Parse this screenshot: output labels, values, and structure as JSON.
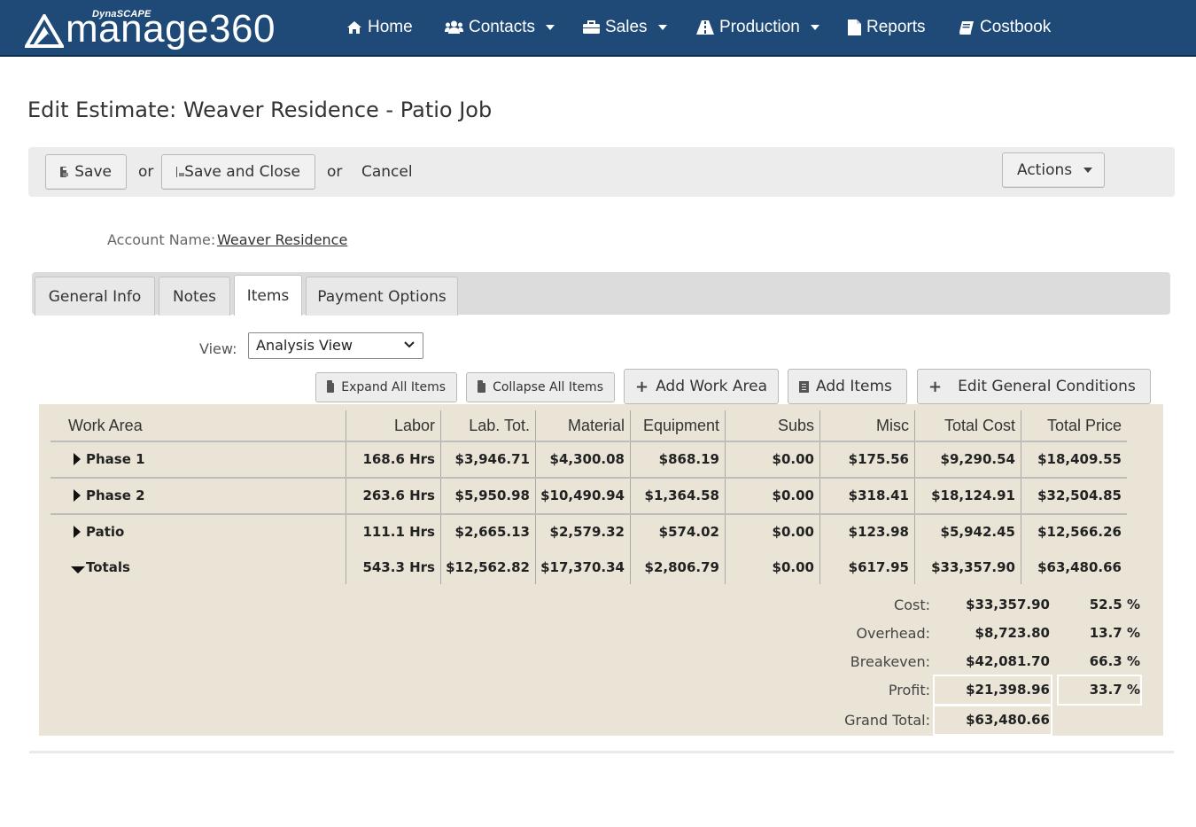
{
  "brand": {
    "small": "DynaSCAPE",
    "big": "manage360"
  },
  "nav": {
    "home": "Home",
    "contacts": "Contacts",
    "sales": "Sales",
    "production": "Production",
    "reports": "Reports",
    "costbook": "Costbook"
  },
  "page": {
    "title": "Edit Estimate: Weaver Residence - Patio Job"
  },
  "toolbar": {
    "save": "Save",
    "or1": "or",
    "save_close": "Save and Close",
    "or2": "or",
    "cancel": "Cancel",
    "actions": "Actions"
  },
  "account": {
    "label": "Account Name:",
    "value": "Weaver Residence"
  },
  "tabs": [
    "General Info",
    "Notes",
    "Items",
    "Payment Options"
  ],
  "active_tab": "Items",
  "view": {
    "label": "View:",
    "selected": "Analysis View"
  },
  "item_actions": {
    "expand": "Expand All Items",
    "collapse": "Collapse All Items",
    "add_work_area": "Add Work Area",
    "add_items": "Add Items",
    "edit_conditions": "Edit General Conditions"
  },
  "table": {
    "headers": [
      "Work Area",
      "Labor",
      "Lab. Tot.",
      "Material",
      "Equipment",
      "Subs",
      "Misc",
      "Total Cost",
      "Total Price"
    ],
    "rows": [
      {
        "name": "Phase 1",
        "expanded": false,
        "cells": [
          "168.6 Hrs",
          "$3,946.71",
          "$4,300.08",
          "$868.19",
          "$0.00",
          "$175.56",
          "$9,290.54",
          "$18,409.55"
        ]
      },
      {
        "name": "Phase 2",
        "expanded": false,
        "cells": [
          "263.6 Hrs",
          "$5,950.98",
          "$10,490.94",
          "$1,364.58",
          "$0.00",
          "$318.41",
          "$18,124.91",
          "$32,504.85"
        ]
      },
      {
        "name": "Patio",
        "expanded": false,
        "cells": [
          "111.1 Hrs",
          "$2,665.13",
          "$2,579.32",
          "$574.02",
          "$0.00",
          "$123.98",
          "$5,942.45",
          "$12,566.26"
        ]
      },
      {
        "name": "Totals",
        "expanded": true,
        "cells": [
          "543.3 Hrs",
          "$12,562.82",
          "$17,370.34",
          "$2,806.79",
          "$0.00",
          "$617.95",
          "$33,357.90",
          "$63,480.66"
        ]
      }
    ]
  },
  "summary": {
    "cost": {
      "label": "Cost:",
      "value": "$33,357.90",
      "pct": "52.5 %"
    },
    "overhead": {
      "label": "Overhead:",
      "value": "$8,723.80",
      "pct": "13.7 %"
    },
    "breakeven": {
      "label": "Breakeven:",
      "value": "$42,081.70",
      "pct": "66.3 %"
    },
    "profit": {
      "label": "Profit:",
      "value": "$21,398.96",
      "pct": "33.7 %"
    },
    "grand_total": {
      "label": "Grand Total:",
      "value": "$63,480.66"
    }
  },
  "colors": {
    "nav_bg": "#1f4a78",
    "panel_bg": "#e9e4d6",
    "toolbar_bg": "#ececec"
  }
}
